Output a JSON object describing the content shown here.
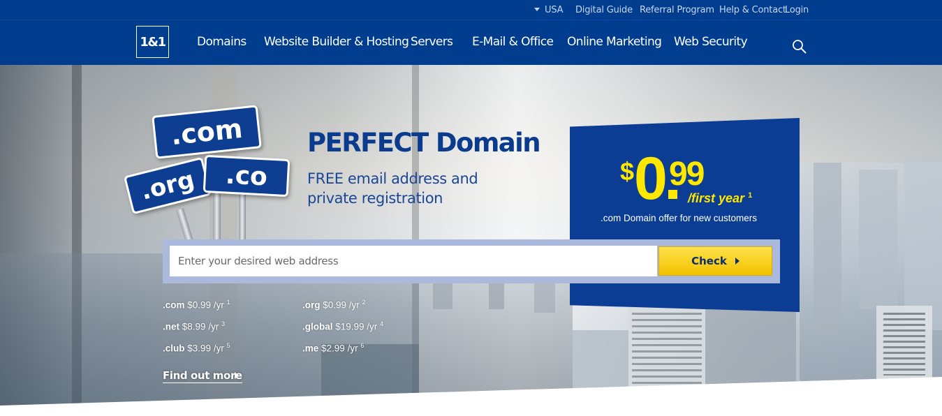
{
  "topbar": {
    "country": "USA",
    "links": [
      "Digital Guide",
      "Referral Program",
      "Help & Contact",
      "Login"
    ]
  },
  "nav": {
    "logo": "1&1",
    "items": [
      "Domains",
      "Website Builder & Hosting",
      "Servers",
      "E-Mail & Office",
      "Online Marketing",
      "Web Security"
    ]
  },
  "hero": {
    "signs": [
      ".com",
      ".org",
      ".co"
    ],
    "headline": "PERFECT Domain",
    "subline1": "FREE email address and",
    "subline2": "private registration"
  },
  "price": {
    "currency": "$",
    "dollars": "0",
    "dot": ".",
    "cents": "99",
    "period": "/first year",
    "footnote": "1",
    "offer": ".com Domain offer for new customers"
  },
  "search": {
    "placeholder": "Enter your desired web address",
    "button": "Check"
  },
  "tlds": [
    {
      "ext": ".com",
      "price": "$0.99 /yr",
      "note": "1"
    },
    {
      "ext": ".org",
      "price": "$0.99 /yr",
      "note": "2"
    },
    {
      "ext": ".net",
      "price": "$8.99 /yr",
      "note": "3"
    },
    {
      "ext": ".global",
      "price": "$19.99 /yr",
      "note": "4"
    },
    {
      "ext": ".club",
      "price": "$3.99 /yr",
      "note": "5"
    },
    {
      "ext": ".me",
      "price": "$2.99 /yr",
      "note": "6"
    }
  ],
  "find_more": "Find out more",
  "colors": {
    "brand_blue": "#003d8f",
    "price_box": "#0a3d93",
    "accent_yellow": "#ffe800",
    "button_yellow": "#f2c200"
  }
}
